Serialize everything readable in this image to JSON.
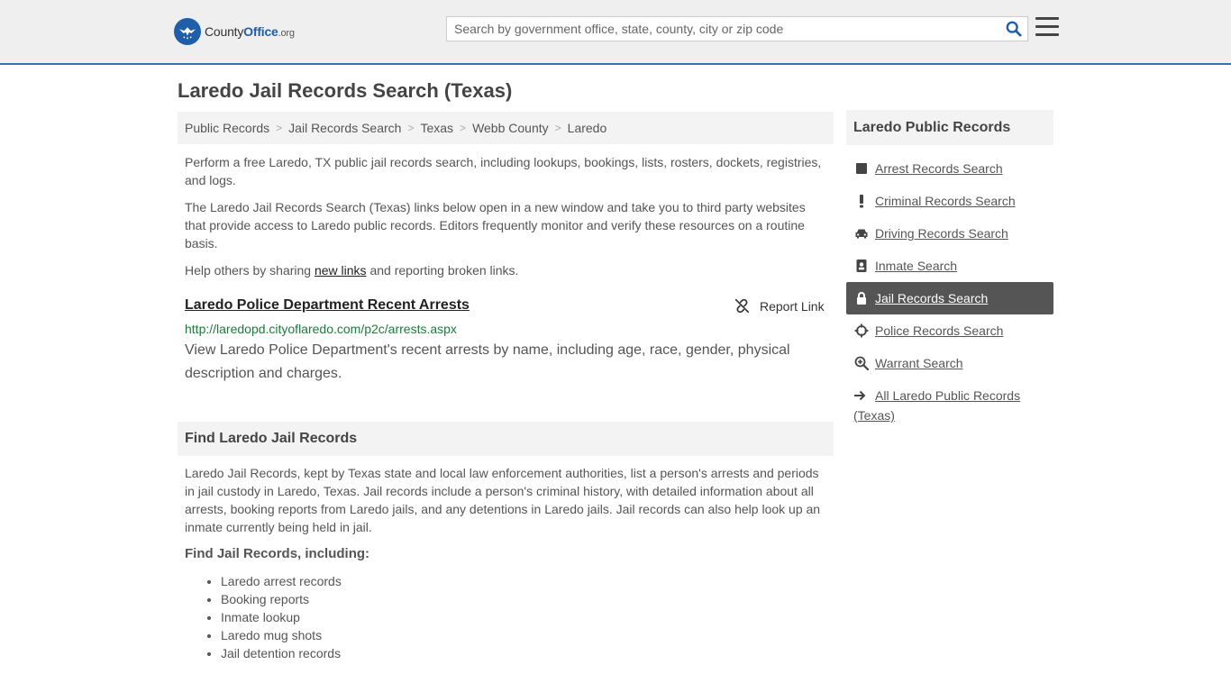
{
  "header": {
    "logo": {
      "part1": "County",
      "part2": "Office",
      "part3": ".org"
    },
    "search": {
      "placeholder": "Search by government office, state, county, city or zip code",
      "value": ""
    },
    "icons": {
      "search": "search-icon",
      "menu": "hamburger-menu-icon"
    },
    "accent_color": "#3a6fb0"
  },
  "page": {
    "title": "Laredo Jail Records Search (Texas)"
  },
  "breadcrumb": [
    "Public Records",
    "Jail Records Search",
    "Texas",
    "Webb County",
    "Laredo"
  ],
  "intro": {
    "p1": "Perform a free Laredo, TX public jail records search, including lookups, bookings, lists, rosters, dockets, registries, and logs.",
    "p2": "The Laredo Jail Records Search (Texas) links below open in a new window and take you to third party websites that provide access to Laredo public records. Editors frequently monitor and verify these resources on a routine basis.",
    "p3_before": "Help others by sharing ",
    "p3_link": "new links",
    "p3_after": " and reporting broken links."
  },
  "listing": {
    "title": "Laredo Police Department Recent Arrests",
    "report_label": "Report Link",
    "url": "http://laredopd.cityoflaredo.com/p2c/arrests.aspx",
    "description": "View Laredo Police Department's recent arrests by name, including age, race, gender, physical description and charges."
  },
  "find_section": {
    "heading": "Find Laredo Jail Records",
    "body": "Laredo Jail Records, kept by Texas state and local law enforcement authorities, list a person's arrests and periods in jail custody in Laredo, Texas. Jail records include a person's criminal history, with detailed information about all arrests, booking reports from Laredo jails, and any detentions in Laredo jails. Jail records can also help look up an inmate currently being held in jail.",
    "subheading": "Find Jail Records, including:",
    "items": [
      "Laredo arrest records",
      "Booking reports",
      "Inmate lookup",
      "Laredo mug shots",
      "Jail detention records"
    ]
  },
  "sidebar": {
    "heading": "Laredo Public Records",
    "items": [
      {
        "label": "Arrest Records Search",
        "icon": "square-icon",
        "active": false
      },
      {
        "label": "Criminal Records Search",
        "icon": "exclamation-icon",
        "active": false
      },
      {
        "label": "Driving Records Search",
        "icon": "car-icon",
        "active": false
      },
      {
        "label": "Inmate Search",
        "icon": "id-badge-icon",
        "active": false
      },
      {
        "label": "Jail Records Search",
        "icon": "lock-icon",
        "active": true
      },
      {
        "label": "Police Records Search",
        "icon": "crosshair-icon",
        "active": false
      },
      {
        "label": "Warrant Search",
        "icon": "zoom-in-icon",
        "active": false
      }
    ],
    "all_link": {
      "label": "All Laredo Public Records (Texas)",
      "icon": "arrow-right-icon"
    },
    "active_color": "#555555"
  }
}
